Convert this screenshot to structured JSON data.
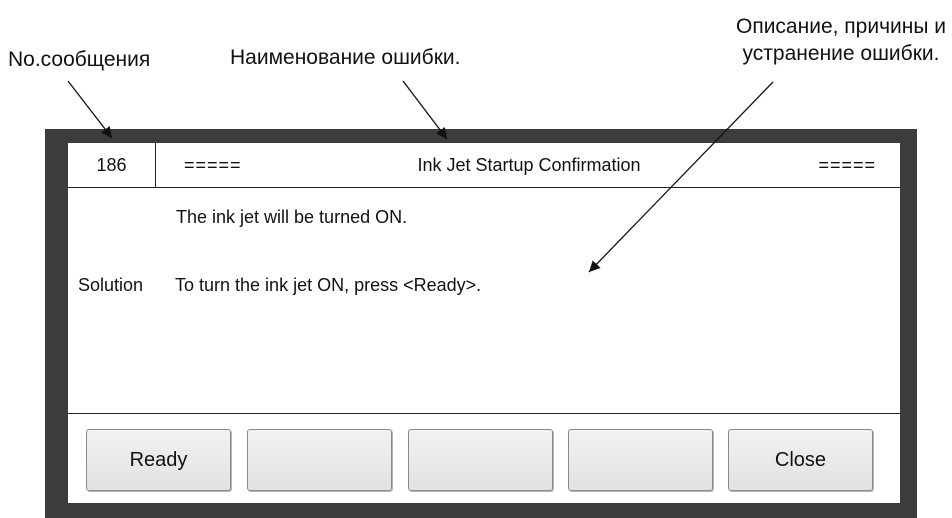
{
  "callouts": {
    "message_number": "No.сообщения",
    "error_name": "Наименование ошибки.",
    "description_line1": "Описание, причины и",
    "description_line2": "устранение ошибки."
  },
  "dialog": {
    "message_number": "186",
    "title_prefix": "=====",
    "title": "Ink Jet Startup Confirmation",
    "title_suffix": "=====",
    "description": "The ink jet will be turned ON.",
    "solution_label": "Solution",
    "solution_text": "To turn the ink jet ON, press <Ready>."
  },
  "buttons": [
    {
      "label": "Ready"
    },
    {
      "label": ""
    },
    {
      "label": ""
    },
    {
      "label": ""
    },
    {
      "label": "Close"
    }
  ]
}
